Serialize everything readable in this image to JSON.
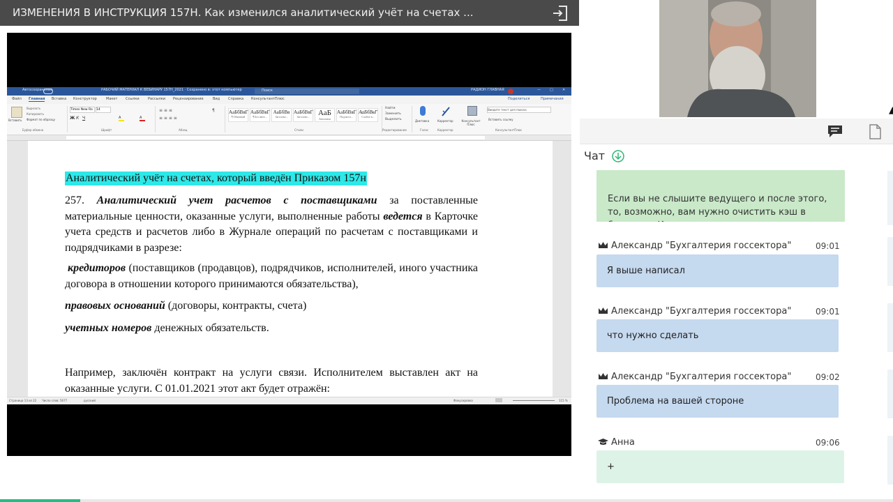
{
  "video": {
    "title": "ИЗМЕНЕНИЯ В ИНСТРУКЦИЯ 157Н. Как изменился аналитический учёт на счетах ...",
    "progress_fraction": 0.09
  },
  "word": {
    "title_left": "Автосохранение",
    "title_doc": "РАБОЧИЙ МАТЕРИАЛ К ВЕБИНАРУ 157Н_2021 · Сохранено в: этот компьютер",
    "search_placeholder": "Поиск",
    "user": "РАДИОН ГЛАВНАЯ",
    "tabs": [
      "Файл",
      "Главная",
      "Вставка",
      "Конструктор",
      "Макет",
      "Ссылки",
      "Рассылки",
      "Рецензирование",
      "Вид",
      "Справка",
      "КонсультантПлюс"
    ],
    "share_label": "Поделиться",
    "notes_label": "Примечания",
    "ribbon": {
      "paste": "Вставить",
      "cut": "Вырезать",
      "copy": "Копировать",
      "format": "Формат по образцу",
      "font_name": "Times New Ro",
      "font_size": "14",
      "styles": [
        {
          "preview": "АаБбВвГ",
          "name": "¶ Обычный"
        },
        {
          "preview": "АаБбВвГ",
          "name": "¶ Без инте..."
        },
        {
          "preview": "АаБбВв",
          "name": "Заголово..."
        },
        {
          "preview": "АаБбВвГ",
          "name": "Заголово..."
        },
        {
          "preview": "АаБ",
          "name": "Заголовок"
        },
        {
          "preview": "АаБбВвГ",
          "name": "Подзагол..."
        },
        {
          "preview": "АаБбВвГ",
          "name": "Слабое в..."
        }
      ],
      "find": "Найти",
      "replace": "Заменить",
      "select": "Выделить",
      "dictate": "Диктовка",
      "editor": "Корректор",
      "consultant": "Консультант Плюс",
      "search_text": "Введите текст для поиска",
      "insert_link": "Вставить ссылку",
      "groups": [
        "Буфер обмена",
        "Шрифт",
        "Абзац",
        "Стили",
        "Редактирование",
        "Голос",
        "Корректор",
        "КонсультантПлюс"
      ]
    },
    "status": {
      "page": "Страница 13 из 22",
      "words": "Число слов: 5677",
      "lang": "русский",
      "focus": "Фокусировка",
      "zoom": "115 %"
    },
    "doc": {
      "heading": "Аналитический учёт на счетах, который введён Приказом 157н",
      "p1_num": "257.",
      "p1_b1": "Аналитический учет расчетов с поставщиками",
      "p1_t1": "за поставленные материальные ценности, оказанные услуги, выполненные работы",
      "p1_b2": "ведется",
      "p1_t2": "в Карточке учета средств и расчетов либо в Журнале операций по расчетам с поставщиками и подрядчиками в разрезе:",
      "p2_b": "кредиторов",
      "p2_t": "(поставщиков (продавцов), подрядчиков, исполнителей, иного участника договора в отношении которого принимаются обязательства),",
      "p3_b": "правовых оснований",
      "p3_t": "(договоры, контракты, счета)",
      "p4_b": "учетных номеров",
      "p4_t": "денежных обязательств.",
      "p5": "Например, заключён контракт на услуги связи. Исполнителем выставлен акт на оказанные услуги. С 01.01.2021 этот акт будет отражён:"
    }
  },
  "chat": {
    "title": "Чат",
    "system_message": "Если вы не слышите ведущего и после этого, то, возможно, вам нужно очистить кэш в браузере. И...",
    "messages": [
      {
        "author": "Александр \"Бухгалтерия госсектора\"",
        "time": "09:01",
        "text": "Я выше написал",
        "role": "crown"
      },
      {
        "author": "Александр \"Бухгалтерия госсектора\"",
        "time": "09:01",
        "text": "что нужно сделать",
        "role": "crown"
      },
      {
        "author": "Александр \"Бухгалтерия госсектора\"",
        "time": "09:02",
        "text": "Проблема на вашей стороне",
        "role": "crown"
      },
      {
        "author": "Анна",
        "time": "09:06",
        "text": "+",
        "role": "graduate"
      }
    ]
  },
  "colors": {
    "topbar": "#4a4a4a",
    "highlight": "#2ee8e8",
    "bubble_blue": "#c5d9ef",
    "bubble_green": "#def3e8",
    "system_green": "#c9e9c9",
    "accent": "#1fbf87",
    "word_blue": "#2b579a"
  },
  "icons": {
    "exit": "exit-icon",
    "chat": "chat-bubble-icon",
    "file": "file-icon",
    "download": "arrow-down-circle-icon",
    "crown": "crown-icon",
    "graduate": "graduation-cap-icon"
  }
}
